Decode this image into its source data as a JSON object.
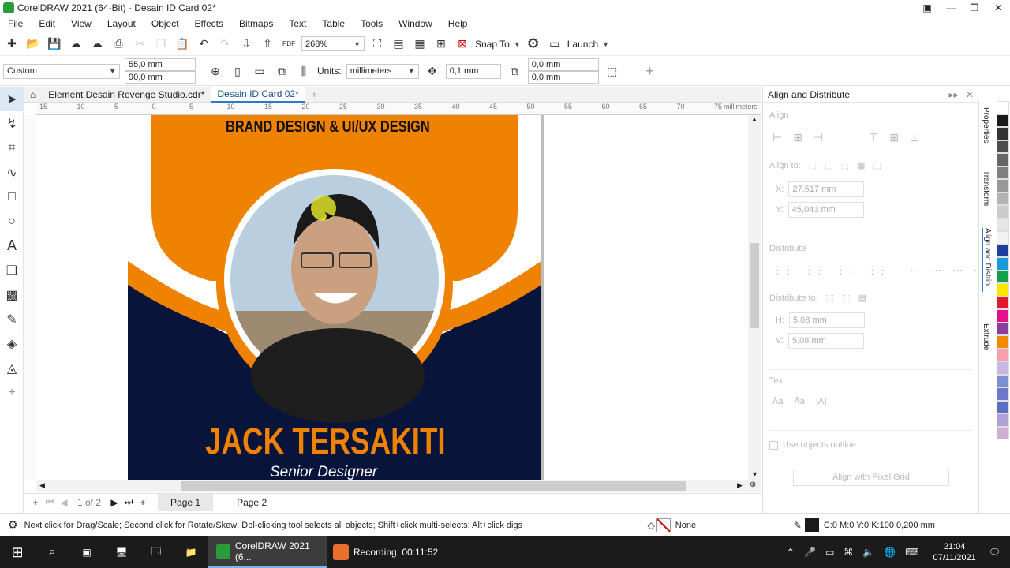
{
  "app": {
    "title": "CorelDRAW 2021 (64-Bit) - Desain ID Card 02*"
  },
  "menu": [
    "File",
    "Edit",
    "View",
    "Layout",
    "Object",
    "Effects",
    "Bitmaps",
    "Text",
    "Table",
    "Tools",
    "Window",
    "Help"
  ],
  "toolbar": {
    "zoom": "268%",
    "snap_label": "Snap To",
    "launch_label": "Launch"
  },
  "propbar": {
    "preset": "Custom",
    "width": "55,0 mm",
    "height": "90,0 mm",
    "units_label": "Units:",
    "units_value": "millimeters",
    "nudge": "0,1 mm",
    "dup_x": "0,0 mm",
    "dup_y": "0,0 mm"
  },
  "tabs": [
    {
      "label": "Element Desain Revenge Studio.cdr*"
    },
    {
      "label": "Desain ID Card 02*"
    }
  ],
  "ruler": {
    "ticks": [
      "15",
      "10",
      "5",
      "0",
      "5",
      "10",
      "15",
      "20",
      "25",
      "30",
      "35",
      "40",
      "45",
      "50",
      "55",
      "60",
      "65",
      "70",
      "75"
    ],
    "unit": "millimeters"
  },
  "card": {
    "brand_line": "BRAND DESIGN & UI/UX DESIGN",
    "name": "JACK TERSAKITI",
    "role": "Senior Designer",
    "colors": {
      "orange": "#ef8200",
      "navy": "#08143a"
    }
  },
  "pages": {
    "counter": "1 of 2",
    "tabs": [
      "Page 1",
      "Page 2"
    ]
  },
  "docker": {
    "title": "Align and Distribute",
    "align_section": "Align",
    "align_to": "Align to:",
    "x_label": "X:",
    "x_value": "27,517 mm",
    "y_label": "Y:",
    "y_value": "45,043 mm",
    "distribute_section": "Distribute",
    "distribute_to": "Distribute to:",
    "h_label": "H:",
    "h_value": "5,08 mm",
    "v_label": "V:",
    "v_value": "5,08 mm",
    "text_section": "Text",
    "use_outline": "Use objects outline",
    "pixel_grid_btn": "Align with Pixel Grid"
  },
  "side_tabs": [
    "Properties",
    "Transform",
    "Align and Distrib...",
    "Extrude"
  ],
  "palette": [
    "#ffffff",
    "#1a1a1a",
    "#333333",
    "#4d4d4d",
    "#666666",
    "#808080",
    "#999999",
    "#b3b3b3",
    "#cccccc",
    "#e6e6e6",
    "#f2f2f2",
    "#1e3fa0",
    "#1a9ad6",
    "#12a04a",
    "#ffe600",
    "#e01a2a",
    "#e3128c",
    "#8d3ca0",
    "#f08a00",
    "#f4a0b0",
    "#c8b7e0",
    "#7c8fd0",
    "#6e78c8",
    "#5d6ec0",
    "#b0a0d8",
    "#d0b0d0"
  ],
  "status": {
    "hint": "Next click for Drag/Scale; Second click for Rotate/Skew; Dbl-clicking tool selects all objects; Shift+click multi-selects; Alt+click digs",
    "fill": "None",
    "outline": "C:0 M:0 Y:0 K:100  0,200 mm"
  },
  "taskbar": {
    "app_label": "CorelDRAW 2021 (6...",
    "recording": "Recording:  00:11:52",
    "time": "21:04",
    "date": "07/11/2021"
  }
}
